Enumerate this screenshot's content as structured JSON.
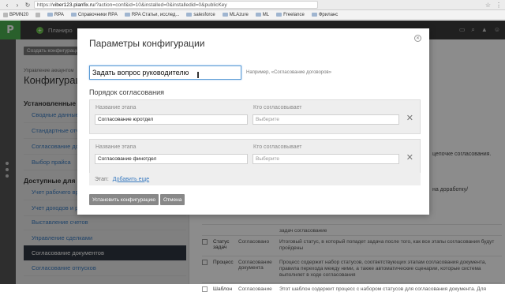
{
  "browser": {
    "url_prefix": "https://",
    "url_host": "viber123.planfix.ru",
    "url_path": "/?action=conf&id=10&installed=0&installedid=0&publicKey",
    "bookmarks": [
      "BPMN20",
      "RPA",
      "Справочники RPA",
      "RPA Статьи, исслед...",
      "salesforce",
      "MLAzure",
      "ML",
      "Freelance",
      "Фриланс"
    ]
  },
  "header": {
    "logo": "P",
    "planner_label": "Планиро"
  },
  "sidebar": {
    "create_button": "Создать конфигурацию",
    "subtitle": "Управление аккаунтом",
    "title": "Конфигурац",
    "installed_section": "Установленные",
    "installed_items": [
      "Сводные данные",
      "Стандартные отче",
      "Согласование доку",
      "Выбор прайса"
    ],
    "available_section": "Доступные для ус",
    "available_items": [
      "Учет рабочего вре",
      "Учет доходов и ра",
      "Выставление счетов",
      "Управление сделками",
      "Согласование документов",
      "Согласование отпусков"
    ]
  },
  "main": {
    "right_text_1": "цепочке согласования.",
    "right_text_2": "на доработку/",
    "table_rows": [
      {
        "c2": "",
        "c3": "",
        "c4": "задач              согласование"
      },
      {
        "c2": "Статус задач",
        "c3": "Согласовано",
        "c4": "Итоговый статус, в который попадет задача после того, как все этапы согласования будут пройдены"
      },
      {
        "c2": "Процесс",
        "c3": "Согласование документа",
        "c4": "Процесс содержит набор статусов, соответствующих этапам согласования документа, правила перехода между ними, а также автоматические сценарии, которые система выполняет в ходе согласования"
      },
      {
        "c2": "Шаблон",
        "c3": "Согласование",
        "c4": "Этот шаблон содержит процесс с набором статусов для согласования документа. Для"
      }
    ]
  },
  "modal": {
    "title": "Параметры конфигурации",
    "close_icon": "close-icon",
    "name_value": "Задать вопрос руководителю",
    "name_hint": "Например, «Согласование договоров»",
    "order_title": "Порядок согласования",
    "stage_label": "Название этапа",
    "approver_label": "Кто согласовывает",
    "approver_placeholder": "Выберите",
    "stages": [
      {
        "name": "Согласование юротдел"
      },
      {
        "name": "Согласование финотдел"
      }
    ],
    "add_stage_prefix": "Этап:",
    "add_stage_link": "Добавить еще",
    "install_button": "Установить конфигурацию",
    "cancel_button": "Отмена"
  },
  "colors": {
    "accent": "#4caf50",
    "link": "#3a7bc0",
    "header": "#3b3b3b",
    "active_item": "#2f3640"
  }
}
